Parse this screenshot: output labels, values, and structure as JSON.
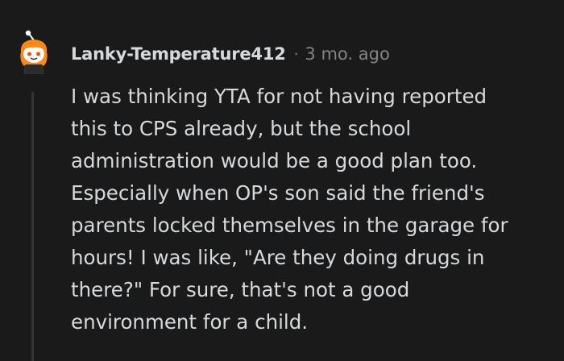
{
  "comment": {
    "author": "Lanky-Temperature412",
    "separator": "·",
    "timestamp": "3 mo. ago",
    "avatar_icon": "snoo-avatar-icon",
    "body_lines": [
      "I was thinking YTA for not having reported",
      "this to CPS already, but the school",
      "administration would be a good plan too.",
      "Especially when OP's son said the friend's",
      "parents locked themselves in the garage for",
      "hours! I was like, \"Are they doing drugs in",
      "there?\" For sure, that's not a good",
      "environment for a child."
    ]
  },
  "colors": {
    "background": "#1a1a1b",
    "text": "#d7dadc",
    "meta": "#818384",
    "thread_line": "#343536",
    "avatar_accent": "#ff8717"
  }
}
